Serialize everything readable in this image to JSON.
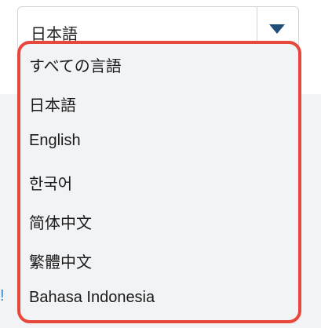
{
  "select": {
    "value": "日本語"
  },
  "dropdown": {
    "options": [
      "すべての言語",
      "日本語",
      "English",
      "한국어",
      "简体中文",
      "繁體中文",
      "Bahasa Indonesia"
    ]
  },
  "colors": {
    "highlight_border": "#e8473b",
    "caret": "#1f4e79",
    "panel_bg": "#f2f3f5"
  }
}
